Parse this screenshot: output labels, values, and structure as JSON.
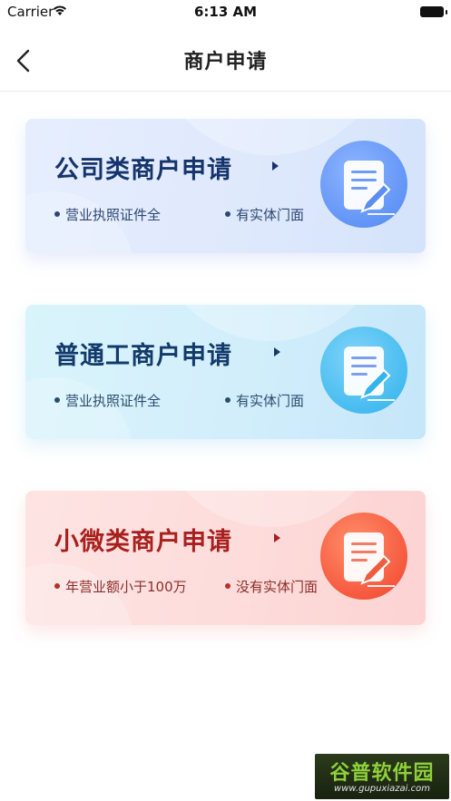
{
  "status_bar": {
    "carrier": "Carrier",
    "time": "6:13 AM"
  },
  "nav": {
    "title": "商户申请"
  },
  "cards": [
    {
      "title": "公司类商户申请",
      "point1": "营业执照证件全",
      "point2": "有实体门面",
      "icon": "document-edit-icon",
      "color": "#15346c"
    },
    {
      "title": "普通工商户申请",
      "point1": "营业执照证件全",
      "point2": "有实体门面",
      "icon": "document-edit-icon",
      "color": "#123a6a"
    },
    {
      "title": "小微类商户申请",
      "point1": "年营业额小于100万",
      "point2": "没有实体门面",
      "icon": "document-edit-icon",
      "color": "#a8201d"
    }
  ],
  "watermark": {
    "logo": "谷普软件园",
    "url": "www.gupuxiazai.com"
  }
}
